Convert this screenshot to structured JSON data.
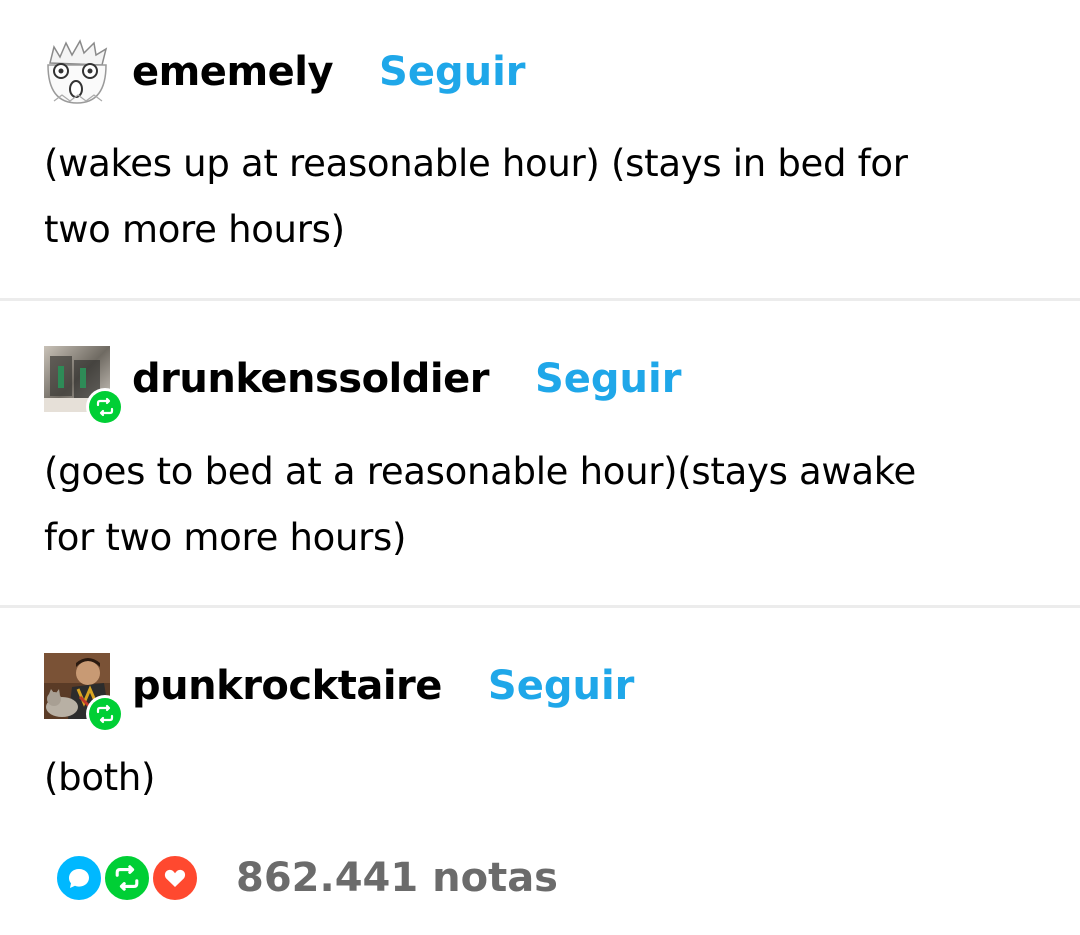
{
  "posts": [
    {
      "username": "ememely",
      "follow_label": "Seguir",
      "reblogged": false,
      "body_lines": [
        "(wakes up at reasonable hour) (stays in bed for",
        "two more hours)"
      ]
    },
    {
      "username": "drunkenssoldier",
      "follow_label": "Seguir",
      "reblogged": true,
      "body_lines": [
        "(goes to bed at a reasonable hour)(stays awake",
        "for two more hours)"
      ]
    },
    {
      "username": "punkrocktaire",
      "follow_label": "Seguir",
      "reblogged": true,
      "body_lines": [
        "(both)"
      ]
    }
  ],
  "notes": {
    "count_label": "862.441 notas",
    "icons": [
      "reply-icon",
      "reblog-icon",
      "like-icon"
    ]
  },
  "colors": {
    "follow_link": "#1fa7e9",
    "reblog_green": "#00cf35",
    "reply_blue": "#00b8ff",
    "like_red": "#ff492f",
    "notes_gray": "#6b6b6b",
    "divider": "#ececec"
  }
}
